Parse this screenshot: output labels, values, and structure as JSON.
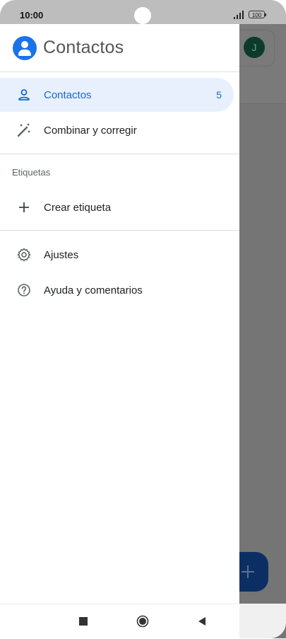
{
  "status_bar": {
    "time": "10:00",
    "battery": "100"
  },
  "app": {
    "title": "Contactos",
    "logo_color": "#1a73e8",
    "accent_color": "#1967d2",
    "active_bg_color": "#e8f0fe"
  },
  "nav": {
    "contacts": {
      "label": "Contactos",
      "count": "5",
      "icon": "person-icon",
      "active": true
    },
    "merge": {
      "label": "Combinar y corregir",
      "icon": "magic-wand-icon"
    }
  },
  "labels_section": {
    "heading": "Etiquetas",
    "create": {
      "label": "Crear etiqueta",
      "icon": "plus-icon"
    }
  },
  "settings_section": {
    "settings": {
      "label": "Ajustes",
      "icon": "gear-icon"
    },
    "help": {
      "label": "Ayuda y comentarios",
      "icon": "help-circle-icon"
    }
  },
  "background": {
    "avatar_letter": "J"
  },
  "system_nav": {
    "recents": "square-icon",
    "home": "circle-icon",
    "back": "triangle-icon"
  }
}
